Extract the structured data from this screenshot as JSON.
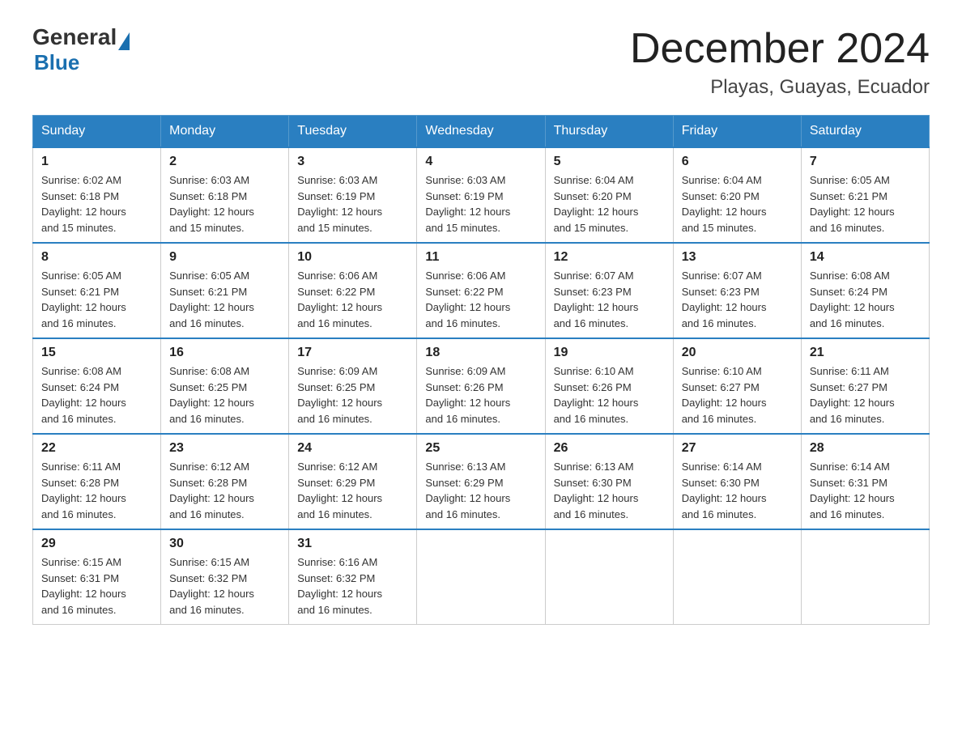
{
  "header": {
    "logo_general": "General",
    "logo_blue": "Blue",
    "title": "December 2024",
    "subtitle": "Playas, Guayas, Ecuador"
  },
  "days_of_week": [
    "Sunday",
    "Monday",
    "Tuesday",
    "Wednesday",
    "Thursday",
    "Friday",
    "Saturday"
  ],
  "weeks": [
    [
      {
        "day": "1",
        "sunrise": "6:02 AM",
        "sunset": "6:18 PM",
        "daylight": "12 hours and 15 minutes."
      },
      {
        "day": "2",
        "sunrise": "6:03 AM",
        "sunset": "6:18 PM",
        "daylight": "12 hours and 15 minutes."
      },
      {
        "day": "3",
        "sunrise": "6:03 AM",
        "sunset": "6:19 PM",
        "daylight": "12 hours and 15 minutes."
      },
      {
        "day": "4",
        "sunrise": "6:03 AM",
        "sunset": "6:19 PM",
        "daylight": "12 hours and 15 minutes."
      },
      {
        "day": "5",
        "sunrise": "6:04 AM",
        "sunset": "6:20 PM",
        "daylight": "12 hours and 15 minutes."
      },
      {
        "day": "6",
        "sunrise": "6:04 AM",
        "sunset": "6:20 PM",
        "daylight": "12 hours and 15 minutes."
      },
      {
        "day": "7",
        "sunrise": "6:05 AM",
        "sunset": "6:21 PM",
        "daylight": "12 hours and 16 minutes."
      }
    ],
    [
      {
        "day": "8",
        "sunrise": "6:05 AM",
        "sunset": "6:21 PM",
        "daylight": "12 hours and 16 minutes."
      },
      {
        "day": "9",
        "sunrise": "6:05 AM",
        "sunset": "6:21 PM",
        "daylight": "12 hours and 16 minutes."
      },
      {
        "day": "10",
        "sunrise": "6:06 AM",
        "sunset": "6:22 PM",
        "daylight": "12 hours and 16 minutes."
      },
      {
        "day": "11",
        "sunrise": "6:06 AM",
        "sunset": "6:22 PM",
        "daylight": "12 hours and 16 minutes."
      },
      {
        "day": "12",
        "sunrise": "6:07 AM",
        "sunset": "6:23 PM",
        "daylight": "12 hours and 16 minutes."
      },
      {
        "day": "13",
        "sunrise": "6:07 AM",
        "sunset": "6:23 PM",
        "daylight": "12 hours and 16 minutes."
      },
      {
        "day": "14",
        "sunrise": "6:08 AM",
        "sunset": "6:24 PM",
        "daylight": "12 hours and 16 minutes."
      }
    ],
    [
      {
        "day": "15",
        "sunrise": "6:08 AM",
        "sunset": "6:24 PM",
        "daylight": "12 hours and 16 minutes."
      },
      {
        "day": "16",
        "sunrise": "6:08 AM",
        "sunset": "6:25 PM",
        "daylight": "12 hours and 16 minutes."
      },
      {
        "day": "17",
        "sunrise": "6:09 AM",
        "sunset": "6:25 PM",
        "daylight": "12 hours and 16 minutes."
      },
      {
        "day": "18",
        "sunrise": "6:09 AM",
        "sunset": "6:26 PM",
        "daylight": "12 hours and 16 minutes."
      },
      {
        "day": "19",
        "sunrise": "6:10 AM",
        "sunset": "6:26 PM",
        "daylight": "12 hours and 16 minutes."
      },
      {
        "day": "20",
        "sunrise": "6:10 AM",
        "sunset": "6:27 PM",
        "daylight": "12 hours and 16 minutes."
      },
      {
        "day": "21",
        "sunrise": "6:11 AM",
        "sunset": "6:27 PM",
        "daylight": "12 hours and 16 minutes."
      }
    ],
    [
      {
        "day": "22",
        "sunrise": "6:11 AM",
        "sunset": "6:28 PM",
        "daylight": "12 hours and 16 minutes."
      },
      {
        "day": "23",
        "sunrise": "6:12 AM",
        "sunset": "6:28 PM",
        "daylight": "12 hours and 16 minutes."
      },
      {
        "day": "24",
        "sunrise": "6:12 AM",
        "sunset": "6:29 PM",
        "daylight": "12 hours and 16 minutes."
      },
      {
        "day": "25",
        "sunrise": "6:13 AM",
        "sunset": "6:29 PM",
        "daylight": "12 hours and 16 minutes."
      },
      {
        "day": "26",
        "sunrise": "6:13 AM",
        "sunset": "6:30 PM",
        "daylight": "12 hours and 16 minutes."
      },
      {
        "day": "27",
        "sunrise": "6:14 AM",
        "sunset": "6:30 PM",
        "daylight": "12 hours and 16 minutes."
      },
      {
        "day": "28",
        "sunrise": "6:14 AM",
        "sunset": "6:31 PM",
        "daylight": "12 hours and 16 minutes."
      }
    ],
    [
      {
        "day": "29",
        "sunrise": "6:15 AM",
        "sunset": "6:31 PM",
        "daylight": "12 hours and 16 minutes."
      },
      {
        "day": "30",
        "sunrise": "6:15 AM",
        "sunset": "6:32 PM",
        "daylight": "12 hours and 16 minutes."
      },
      {
        "day": "31",
        "sunrise": "6:16 AM",
        "sunset": "6:32 PM",
        "daylight": "12 hours and 16 minutes."
      },
      null,
      null,
      null,
      null
    ]
  ],
  "labels": {
    "sunrise": "Sunrise:",
    "sunset": "Sunset:",
    "daylight": "Daylight:"
  }
}
